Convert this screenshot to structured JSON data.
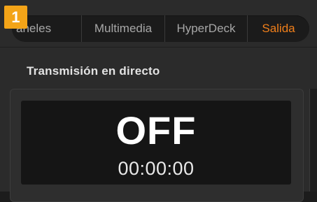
{
  "step_badge": "1",
  "tabs": [
    {
      "label": "aneles",
      "active": false
    },
    {
      "label": "Multimedia",
      "active": false
    },
    {
      "label": "HyperDeck",
      "active": false
    },
    {
      "label": "Salida",
      "active": true
    }
  ],
  "section": {
    "title": "Transmisión en directo"
  },
  "stream": {
    "status": "OFF",
    "timecode": "00:00:00"
  },
  "colors": {
    "accent": "#f07f1b",
    "badge": "#f3a418"
  }
}
